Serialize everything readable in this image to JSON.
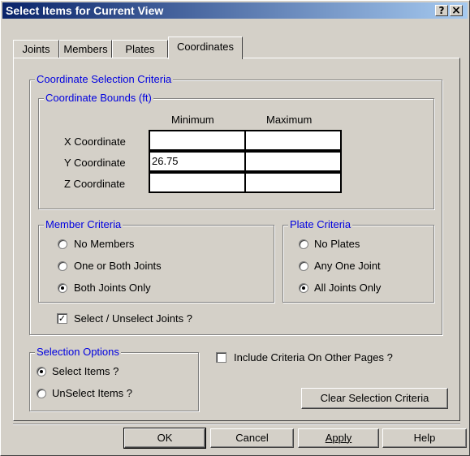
{
  "window": {
    "title": "Select Items for Current View",
    "help_glyph": "?",
    "close_glyph": "×"
  },
  "tabs": [
    {
      "label": "Joints"
    },
    {
      "label": "Members"
    },
    {
      "label": "Plates"
    },
    {
      "label": "Coordinates",
      "active": true
    }
  ],
  "coord_criteria": {
    "legend": "Coordinate Selection Criteria",
    "bounds": {
      "legend": "Coordinate Bounds  (ft)",
      "min_header": "Minimum",
      "max_header": "Maximum",
      "rows": [
        {
          "label": "X Coordinate",
          "min": "",
          "max": ""
        },
        {
          "label": "Y Coordinate",
          "min": "26.75",
          "max": ""
        },
        {
          "label": "Z Coordinate",
          "min": "",
          "max": ""
        }
      ]
    },
    "member_criteria": {
      "legend": "Member Criteria",
      "options": [
        {
          "label": "No Members",
          "selected": false
        },
        {
          "label": "One or Both Joints",
          "selected": false
        },
        {
          "label": "Both Joints Only",
          "selected": true
        }
      ]
    },
    "plate_criteria": {
      "legend": "Plate Criteria",
      "options": [
        {
          "label": "No Plates",
          "selected": false
        },
        {
          "label": "Any One Joint",
          "selected": false
        },
        {
          "label": "All Joints Only",
          "selected": true
        }
      ]
    },
    "select_joints": {
      "label": "Select / Unselect Joints ?",
      "checked": true,
      "mark": "✓"
    }
  },
  "selection_options": {
    "legend": "Selection Options",
    "options": [
      {
        "label": "Select Items ?",
        "selected": true
      },
      {
        "label": "UnSelect Items ?",
        "selected": false
      }
    ]
  },
  "include_other_pages": {
    "label": "Include Criteria On Other Pages ?",
    "checked": false
  },
  "clear_button": "Clear Selection Criteria",
  "footer": {
    "ok": "OK",
    "cancel": "Cancel",
    "apply": "Apply",
    "help": "Help"
  }
}
